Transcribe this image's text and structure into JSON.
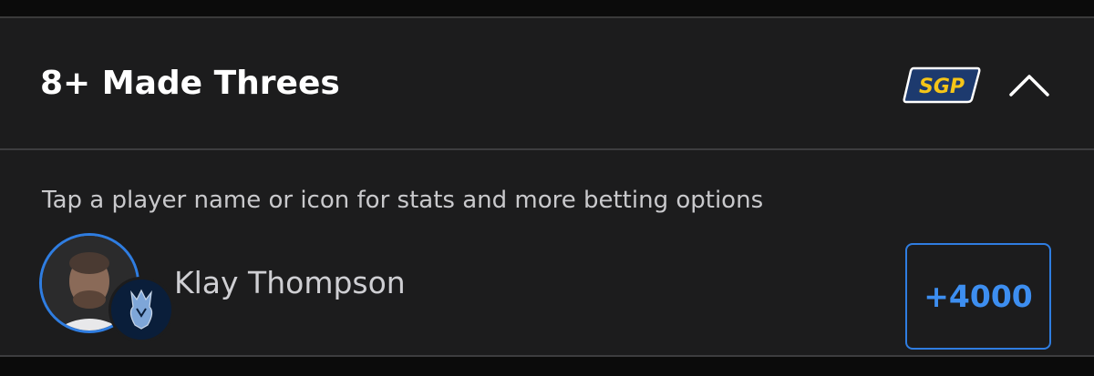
{
  "market": {
    "title": "8+ Made Threes",
    "badge_label": "SGP",
    "badge_colors": {
      "background": "#1d3a6e",
      "text": "#f5c518",
      "border": "#ffffff"
    },
    "toggle_icon": "chevron-up-icon"
  },
  "hint_text": "Tap a player name or icon for stats and more betting options",
  "players": [
    {
      "name": "Klay Thompson",
      "odds": "+4000",
      "team_logo_icon": "team-logo-icon"
    }
  ],
  "colors": {
    "card_background": "#1c1c1d",
    "accent_blue": "#2f7de1",
    "odds_text": "#3d8ef0"
  }
}
